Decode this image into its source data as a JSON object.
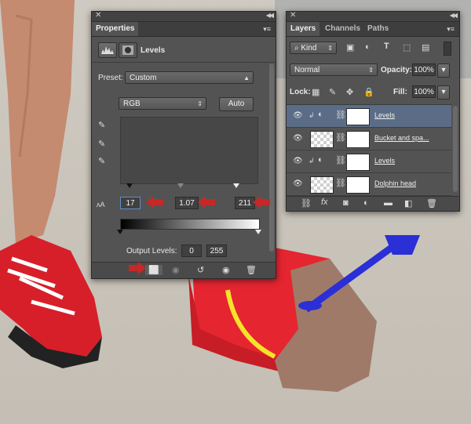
{
  "properties": {
    "tab": "Properties",
    "adjustment_label": "Levels",
    "preset_label": "Preset:",
    "preset_value": "Custom",
    "channel_value": "RGB",
    "auto_label": "Auto",
    "input_black": "17",
    "input_gamma": "1.07",
    "input_white": "211",
    "output_label": "Output Levels:",
    "output_black": "0",
    "output_white": "255"
  },
  "layers": {
    "tabs": [
      "Layers",
      "Channels",
      "Paths"
    ],
    "kind_label": "Kind",
    "blend_mode": "Normal",
    "opacity_label": "Opacity:",
    "opacity_value": "100%",
    "lock_label": "Lock:",
    "fill_label": "Fill:",
    "fill_value": "100%",
    "rows": [
      {
        "name": "Levels"
      },
      {
        "name": "Bucket and spa..."
      },
      {
        "name": "Levels"
      },
      {
        "name": "Dolphin head"
      }
    ]
  },
  "colors": {
    "accent_red": "#c62828",
    "selection": "#5b6d86",
    "panel": "#535353"
  }
}
